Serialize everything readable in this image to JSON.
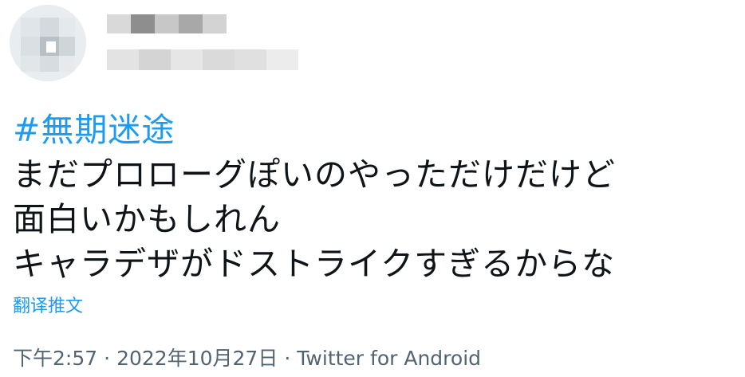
{
  "header": {
    "avatar_icon": "blurred-avatar",
    "display_name_icon": "blurred-display-name",
    "handle_icon": "blurred-handle"
  },
  "tweet": {
    "hashtag": "#無期迷途",
    "lines": [
      "まだプロローグぽいのやっただけだけど",
      "面白いかもしれん",
      "キャラデザがドストライクすぎるからな"
    ],
    "translate_label": "翻译推文"
  },
  "meta": {
    "time": "下午2:57",
    "separator": "·",
    "date": "2022年10月27日",
    "source": "Twitter for Android"
  },
  "colors": {
    "link": "#1d9bf0",
    "text": "#0f1419",
    "meta": "#536471"
  }
}
